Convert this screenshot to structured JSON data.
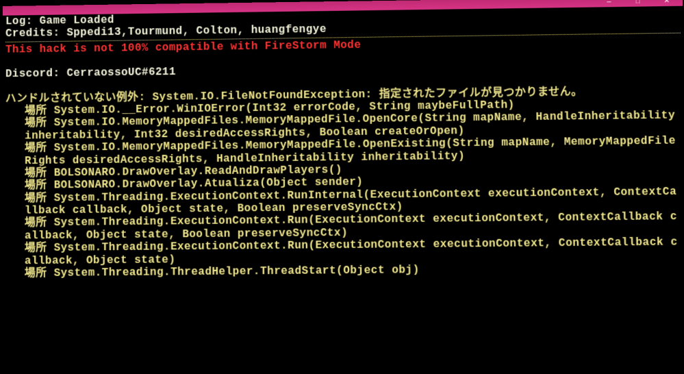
{
  "window": {
    "minimize": "—",
    "maximize": "□",
    "close": "✕"
  },
  "console": {
    "log_line": "Log: Game Loaded",
    "credits_line": "Credits: Sppedi13,Tourmund, Colton, huangfengye",
    "warning_line": "This hack is not 100% compatible with FireStorm Mode",
    "discord_line": "Discord: CerraossoUC#6211",
    "exception_header": "ハンドルされていない例外: System.IO.FileNotFoundException: 指定されたファイルが見つかりません。",
    "stack": [
      "場所 System.IO.__Error.WinIOError(Int32 errorCode, String maybeFullPath)",
      "場所 System.IO.MemoryMappedFiles.MemoryMappedFile.OpenCore(String mapName, HandleInheritability inheritability, Int32 desiredAccessRights, Boolean createOrOpen)",
      "場所 System.IO.MemoryMappedFiles.MemoryMappedFile.OpenExisting(String mapName, MemoryMappedFileRights desiredAccessRights, HandleInheritability inheritability)",
      "場所 BOLSONARO.DrawOverlay.ReadAndDrawPlayers()",
      "場所 BOLSONARO.DrawOverlay.Atualiza(Object sender)",
      "場所 System.Threading.ExecutionContext.RunInternal(ExecutionContext executionContext, ContextCallback callback, Object state, Boolean preserveSyncCtx)",
      "場所 System.Threading.ExecutionContext.Run(ExecutionContext executionContext, ContextCallback callback, Object state, Boolean preserveSyncCtx)",
      "場所 System.Threading.ExecutionContext.Run(ExecutionContext executionContext, ContextCallback callback, Object state)",
      "",
      "場所 System.Threading.ThreadHelper.ThreadStart(Object obj)"
    ]
  }
}
